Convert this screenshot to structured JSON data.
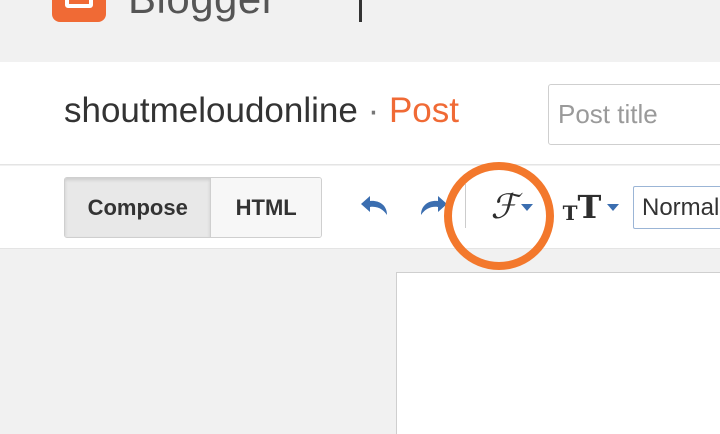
{
  "header": {
    "app_name": "Blogger",
    "colors": {
      "brand": "#f06a35",
      "highlight_ring": "#f3782c"
    }
  },
  "post_header": {
    "blog_name": "shoutmeloudonline",
    "separator": "·",
    "section": "Post",
    "title_placeholder": "Post title"
  },
  "toolbar": {
    "compose_label": "Compose",
    "html_label": "HTML",
    "undo_icon": "undo-icon",
    "redo_icon": "redo-icon",
    "font_icon": "font-family-icon",
    "font_glyph": "ℱ",
    "size_icon": "font-size-icon",
    "size_glyph_small": "T",
    "size_glyph_big": "T",
    "format_value": "Normal"
  }
}
